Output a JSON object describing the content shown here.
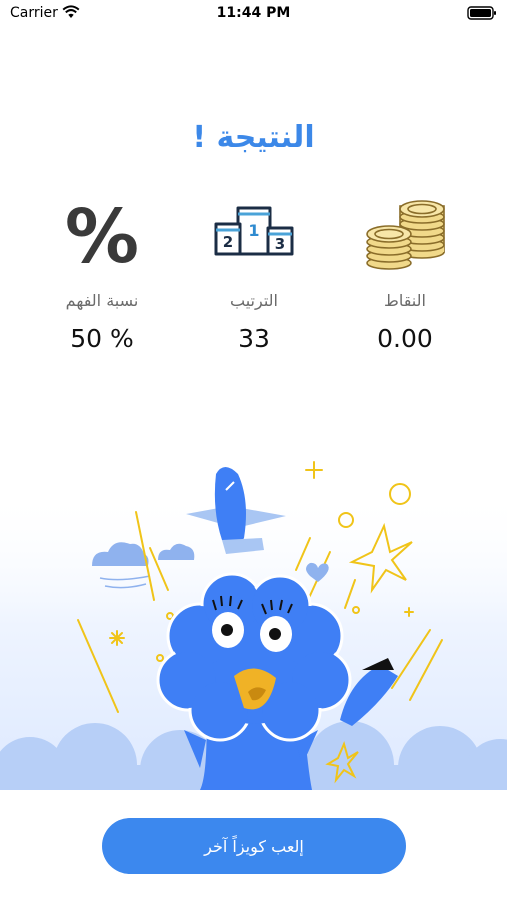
{
  "status_bar": {
    "carrier": "Carrier",
    "time": "11:44 PM"
  },
  "result": {
    "title": "النتيجة !"
  },
  "stats": {
    "points": {
      "label": "النقاط",
      "value": "0.00",
      "icon": "coins-icon"
    },
    "rank": {
      "label": "الترتيب",
      "value": "33",
      "icon": "podium-icon",
      "podium_numbers": [
        "2",
        "1",
        "3"
      ]
    },
    "comprehension": {
      "label": "نسبة الفهم",
      "value": "50 %",
      "symbol": "%"
    }
  },
  "actions": {
    "play_again_label": "إلعب كويزاً آخر"
  },
  "colors": {
    "accent": "#3c88ee",
    "title": "#3c88e8",
    "mascot": "#3f7ff5",
    "coin": "#f1d98a",
    "doodle": "#f0c419"
  }
}
